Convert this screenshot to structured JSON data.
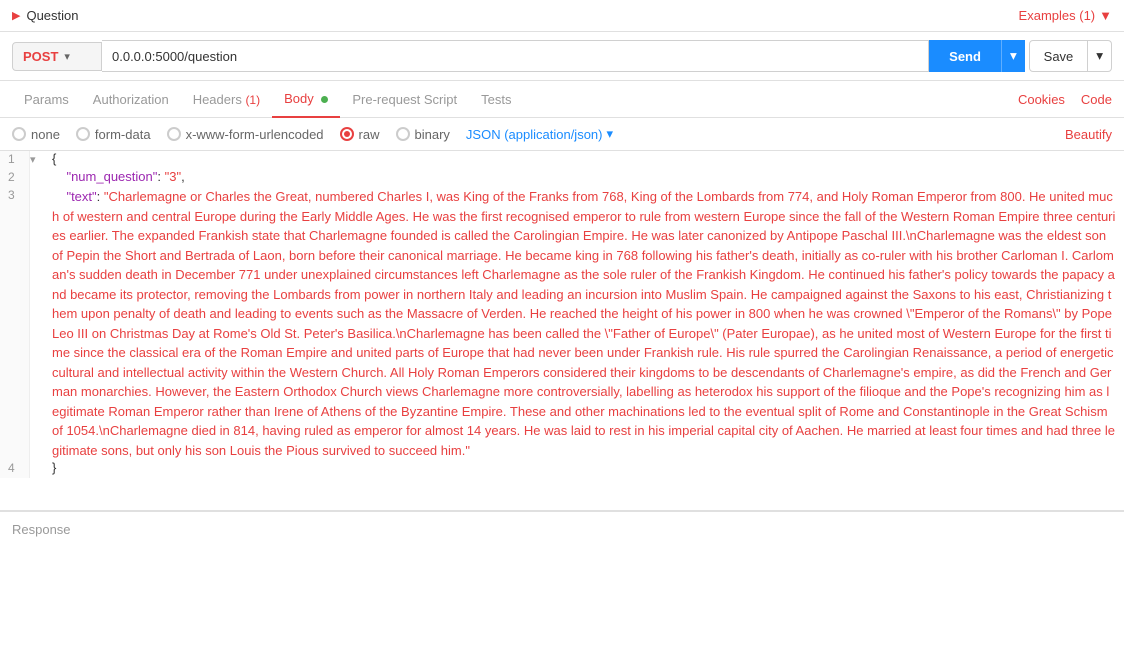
{
  "topbar": {
    "title": "Question",
    "arrow": "▶",
    "examples_label": "Examples (1)",
    "examples_arrow": "▼"
  },
  "urlbar": {
    "method": "POST",
    "url": "0.0.0.0:5000/question",
    "send_label": "Send",
    "save_label": "Save"
  },
  "tabs": {
    "items": [
      {
        "label": "Params",
        "active": false,
        "badge": ""
      },
      {
        "label": "Authorization",
        "active": false,
        "badge": ""
      },
      {
        "label": "Headers",
        "active": false,
        "badge": " (1)"
      },
      {
        "label": "Body",
        "active": true,
        "badge": "",
        "dot": true
      },
      {
        "label": "Pre-request Script",
        "active": false,
        "badge": ""
      },
      {
        "label": "Tests",
        "active": false,
        "badge": ""
      }
    ],
    "right_links": [
      "Cookies",
      "Code"
    ]
  },
  "body_types": {
    "options": [
      "none",
      "form-data",
      "x-www-form-urlencoded",
      "raw",
      "binary"
    ],
    "selected": "raw",
    "json_format": "JSON (application/json)",
    "beautify_label": "Beautify"
  },
  "code": {
    "json_content": "{\n    \"num_question\": \"3\",\n    \"text\": \"Charlemagne or Charles the Great, numbered Charles I, was King of the Franks from 768, King of the Lombards from 774, and Holy Roman Emperor from 800. He united much of western and central Europe during the Early Middle Ages. He was the first recognised emperor to rule from western Europe since the fall of the Western Roman Empire three centuries earlier. The expanded Frankish state that Charlemagne founded is called the Carolingian Empire. He was later canonized by Antipope Paschal III.\\nCharlemagne was the eldest son of Pepin the Short and Bertrada of Laon, born before their canonical marriage. He became king in 768 following his father's death, initially as co-ruler with his brother Carloman I. Carloman's sudden death in December 771 under unexplained circumstances left Charlemagne as the sole ruler of the Frankish Kingdom. He continued his father's policy towards the papacy and became its protector, removing the Lombards from power in northern Italy and leading an incursion into Muslim Spain. He campaigned against the Saxons to his east, Christianizing them upon penalty of death and leading to events such as the Massacre of Verden. He reached the height of his power in 800 when he was crowned \\\"Emperor of the Romans\\\" by Pope Leo III on Christmas Day at Rome's Old St. Peter's Basilica.\\nCharlemagne has been called the \\\"Father of Europe\\\" (Pater Europae), as he united most of Western Europe for the first time since the classical era of the Roman Empire and united parts of Europe that had never been under Frankish rule. His rule spurred the Carolingian Renaissance, a period of energetic cultural and intellectual activity within the Western Church. All Holy Roman Emperors considered their kingdoms to be descendants of Charlemagne's empire, as did the French and German monarchies. However, the Eastern Orthodox Church views Charlemagne more controversially, labelling as heterodox his support of the filioque and the Pope's recognizing him as legitimate Roman Emperor rather than Irene of Athens of the Byzantine Empire. These and other machinations led to the eventual split of Rome and Constantinople in the Great Schism of 1054.\\nCharlemagne died in 814, having ruled as emperor for almost 14 years. He was laid to rest in his imperial capital city of Aachen. He married at least four times and had three legitimate sons, but only his son Louis the Pious survived to succeed him.\"\n}"
  },
  "response": {
    "label": "Response"
  }
}
